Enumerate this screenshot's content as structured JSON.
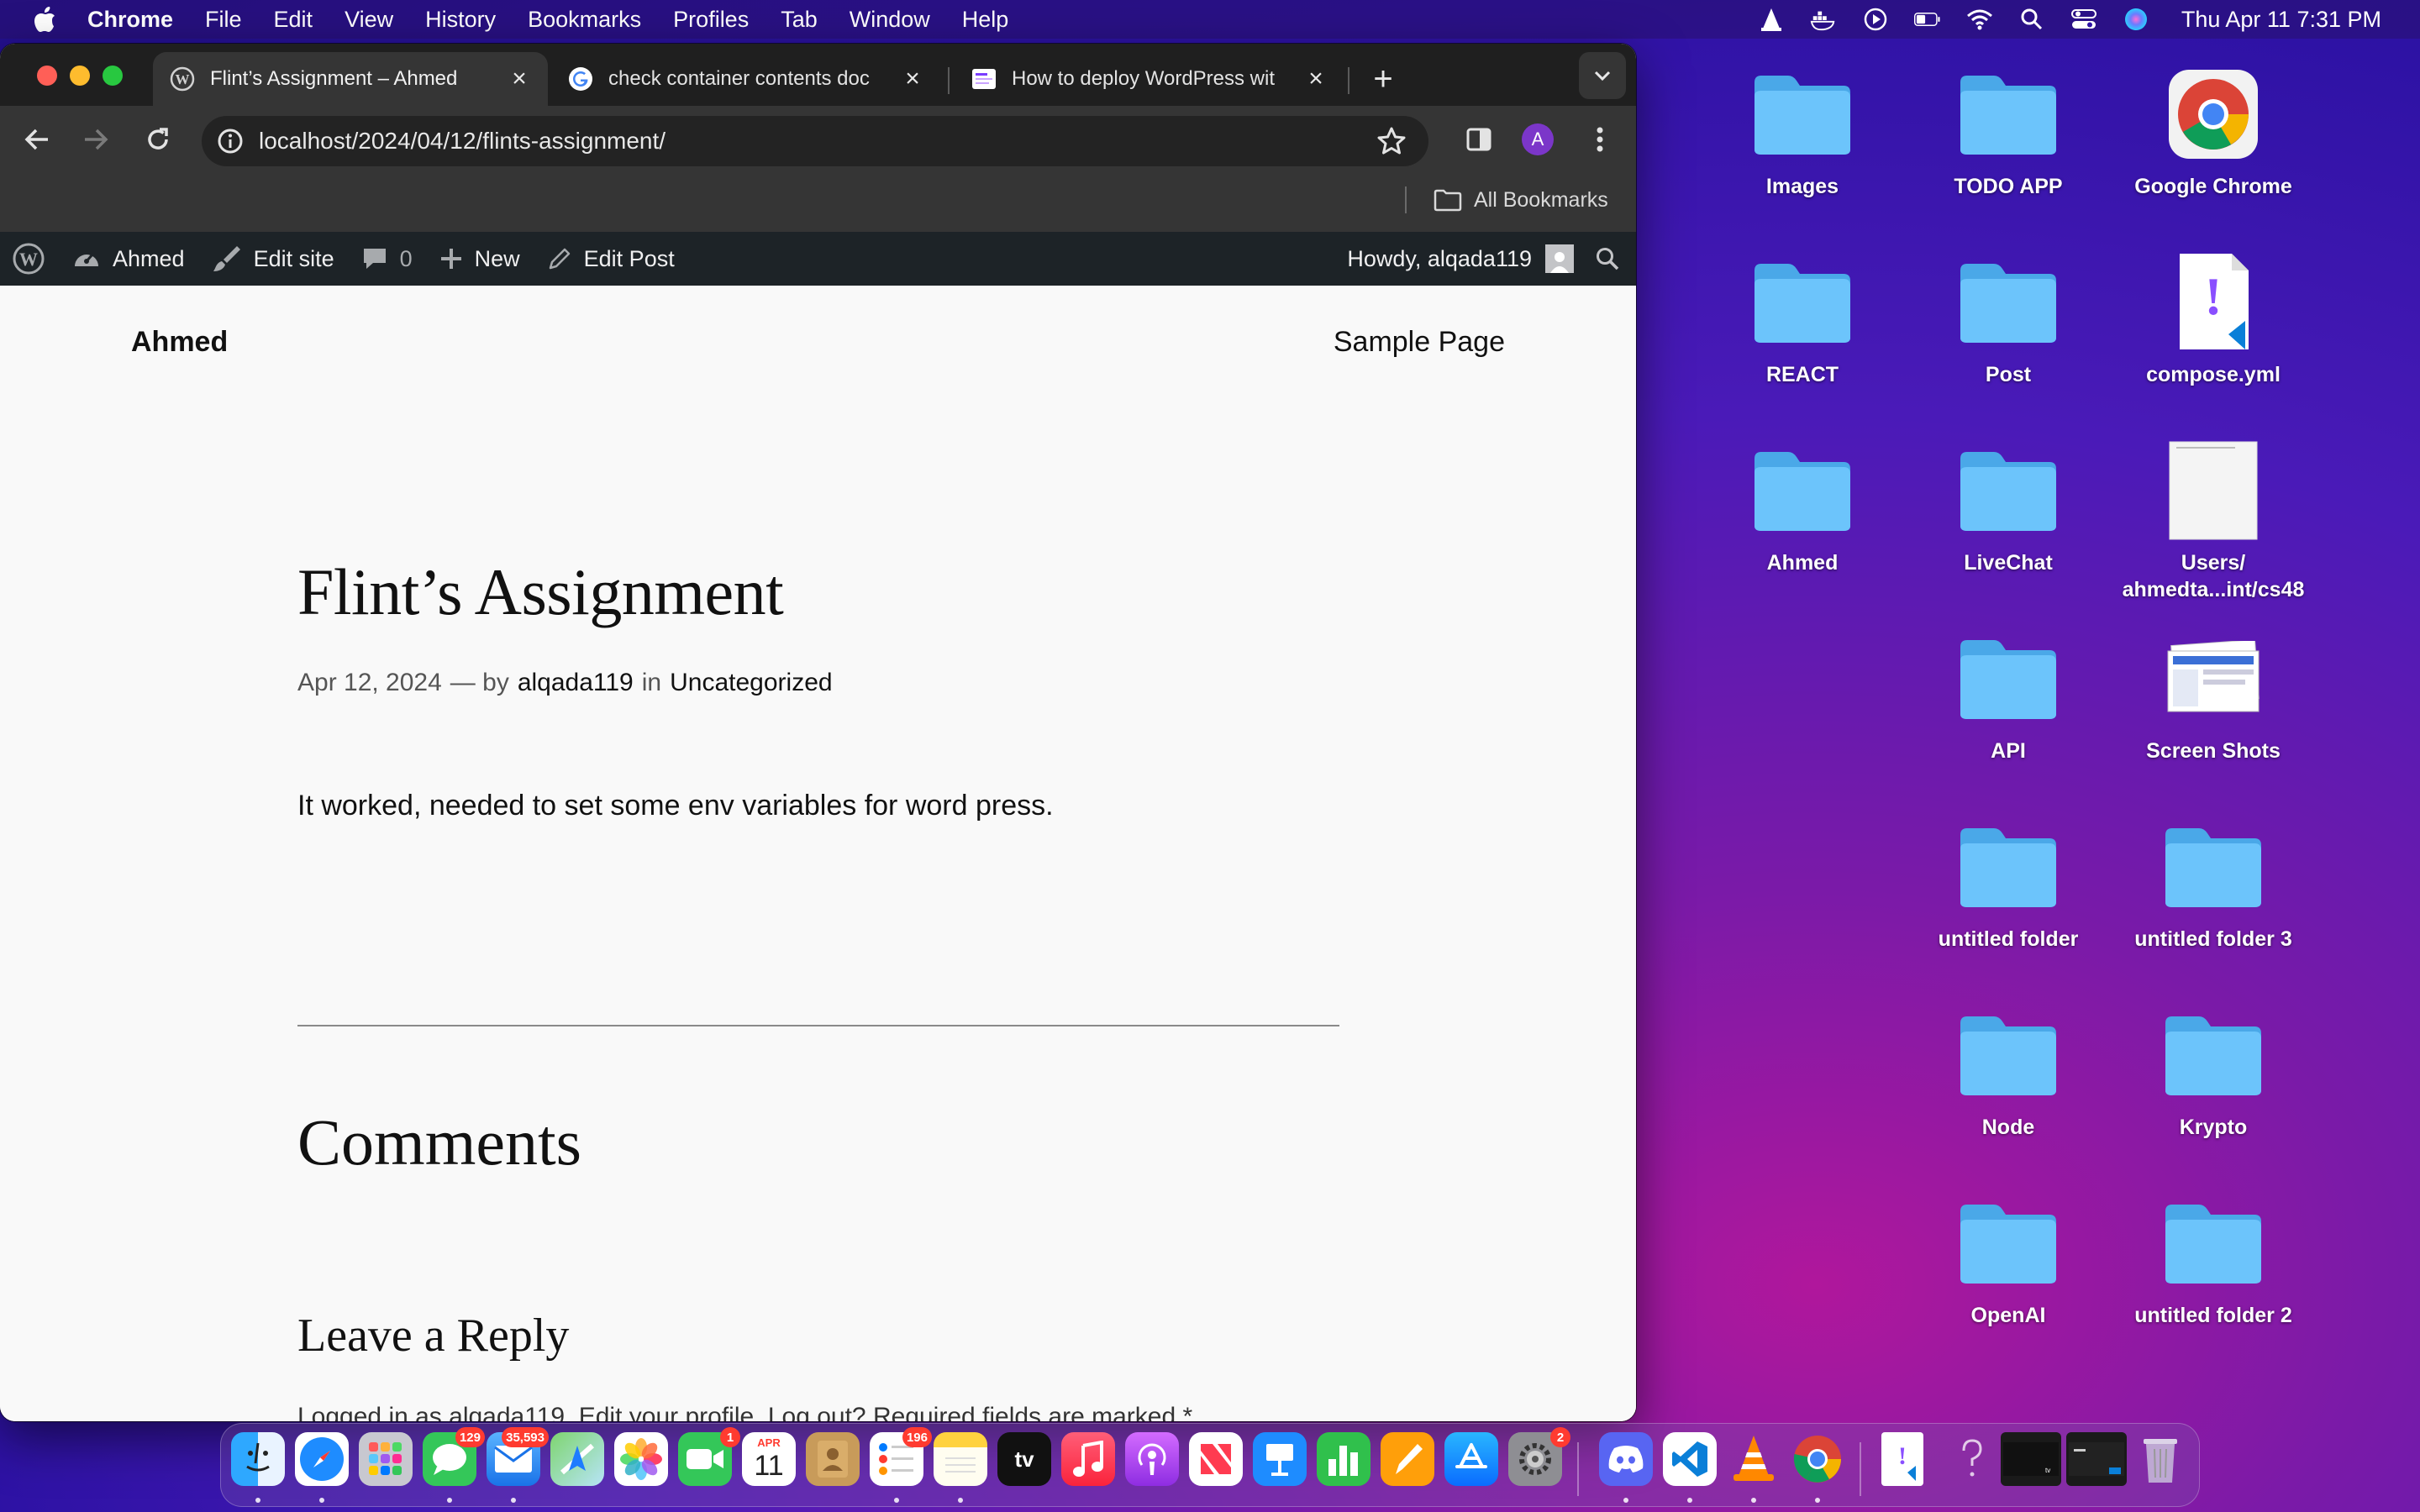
{
  "menubar": {
    "app_name": "Chrome",
    "items": [
      "File",
      "Edit",
      "View",
      "History",
      "Bookmarks",
      "Profiles",
      "Tab",
      "Window",
      "Help"
    ],
    "clock": "Thu Apr 11  7:31 PM"
  },
  "browser": {
    "tabs": [
      {
        "title": "Flint’s Assignment – Ahmed",
        "favicon": "wordpress-icon",
        "active": true
      },
      {
        "title": "check container contents doc",
        "favicon": "google-icon",
        "active": false
      },
      {
        "title": "How to deploy WordPress wit",
        "favicon": "page-icon",
        "active": false
      }
    ],
    "url": "localhost/2024/04/12/flints-assignment/",
    "profile_initial": "A",
    "bookmarks_label": "All Bookmarks"
  },
  "wp_admin_bar": {
    "site_name": "Ahmed",
    "edit_site": "Edit site",
    "comments_count": "0",
    "new_label": "New",
    "edit_post": "Edit Post",
    "howdy": "Howdy, alqada119"
  },
  "page": {
    "site_title": "Ahmed",
    "nav_link": "Sample Page",
    "post_title": "Flint’s Assignment",
    "post_date": "Apr 12, 2024",
    "by_label": "— by",
    "author": "alqada119",
    "in_label": "in",
    "category": "Uncategorized",
    "body": "It worked, needed to set some env variables for word press.",
    "comments_heading": "Comments",
    "reply_heading": "Leave a Reply",
    "reply_subtext": "Logged in as alqada119. Edit your profile. Log out? Required fields are marked *"
  },
  "desktop": {
    "icons": [
      {
        "label": "Images",
        "type": "folder"
      },
      {
        "label": "TODO APP",
        "type": "folder"
      },
      {
        "label": "Google Chrome",
        "type": "chrome"
      },
      {
        "label": "REACT",
        "type": "folder"
      },
      {
        "label": "Post",
        "type": "folder"
      },
      {
        "label": "compose.yml",
        "type": "yml"
      },
      {
        "label": "Ahmed",
        "type": "folder"
      },
      {
        "label": "LiveChat",
        "type": "folder"
      },
      {
        "label": "Users/\nahmedta...int/cs48",
        "type": "document"
      },
      {
        "label": "API",
        "type": "folder"
      },
      {
        "label": "Screen Shots",
        "type": "screenshots"
      },
      {
        "label": "untitled folder",
        "type": "folder"
      },
      {
        "label": "untitled folder 3",
        "type": "folder"
      },
      {
        "label": "Node",
        "type": "folder"
      },
      {
        "label": "Krypto",
        "type": "folder"
      },
      {
        "label": "OpenAI",
        "type": "folder"
      },
      {
        "label": "untitled folder 2",
        "type": "folder"
      }
    ]
  },
  "dock": {
    "badges": {
      "messages": "129",
      "mail": "35,593",
      "facetime": "1",
      "reminders": "196",
      "settings": "2"
    },
    "calendar_month": "APR",
    "calendar_day": "11",
    "tv_label": "tv"
  },
  "colors": {
    "wp_admin_bg": "#1d2327",
    "chrome_toolbar": "#353535",
    "folder_blue": "#5ab8f5"
  }
}
